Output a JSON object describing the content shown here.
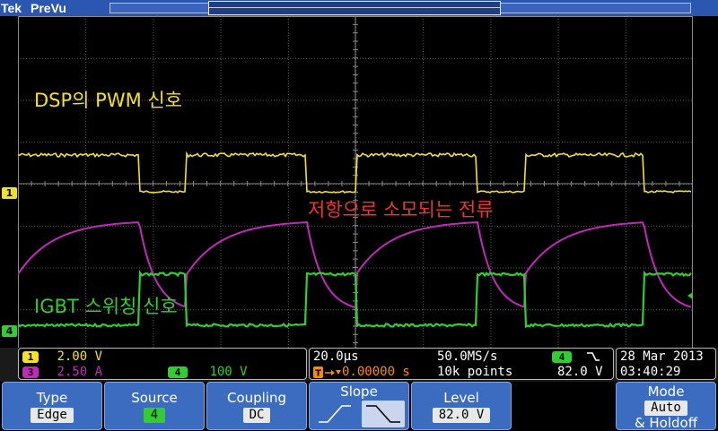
{
  "header": {
    "brand": "Tek",
    "mode": "PreVu",
    "trigger_marker": "T"
  },
  "annotations": {
    "dsp": "DSP의 PWM 신호",
    "resistor": "저항으로 소모되는 전류",
    "igbt": "IGBT 스위칭 신호"
  },
  "channel_markers": {
    "ch1": "1",
    "ch4": "4"
  },
  "channels": [
    {
      "id": "1",
      "scale": "2.00 V",
      "color": "#f2e02a"
    },
    {
      "id": "3",
      "scale": "2.50 A",
      "color": "#c02ab8"
    },
    {
      "id": "4",
      "scale": "100 V",
      "color": "#33cc33"
    }
  ],
  "timebase": {
    "scale": "20.0µs",
    "sample_rate": "50.0MS/s",
    "trigger_position": "0.00000 s",
    "record_length": "10k points",
    "trigger_source": "4",
    "trigger_level": "82.0 V"
  },
  "datetime": {
    "date": "28 Mar 2013",
    "time": "03:40:29"
  },
  "softkeys": {
    "type": {
      "label": "Type",
      "value": "Edge"
    },
    "source": {
      "label": "Source",
      "value": "4"
    },
    "coupling": {
      "label": "Coupling",
      "value": "DC"
    },
    "slope": {
      "label": "Slope"
    },
    "level": {
      "label": "Level",
      "value": "82.0 V"
    },
    "mode": {
      "label": "Mode",
      "value": "Auto",
      "extra": "& Holdoff"
    }
  },
  "colors": {
    "ch1": "#f2e02a",
    "ch3": "#c02ab8",
    "ch4": "#33cc33",
    "trigger": "#ff8a00",
    "accent": "#3c6cc0"
  }
}
